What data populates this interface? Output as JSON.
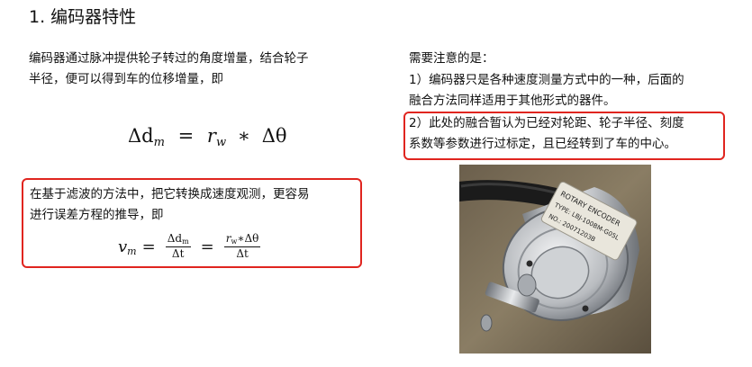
{
  "title": "1. 编码器特性",
  "left": {
    "paragraph_lines": [
      "编码器通过脉冲提供轮子转过的角度增量，结合轮子",
      "半径，便可以得到车的位移增量，即"
    ],
    "equation1": {
      "lhs": "Δd",
      "lhs_sub": "m",
      "equals": "=",
      "r": "r",
      "r_sub": "w",
      "times": "∗",
      "rhs": "Δθ"
    },
    "boxed": {
      "lines": [
        "在基于滤波的方法中，把它转换成速度观测，更容易",
        "进行误差方程的推导，即"
      ],
      "equation2": {
        "v": "v",
        "v_sub": "m",
        "equals1": "=",
        "frac1_num": "Δd",
        "frac1_num_sub": "m",
        "frac1_den": "Δt",
        "equals2": "=",
        "frac2_num_r": "r",
        "frac2_num_r_sub": "w",
        "frac2_num_rest": "∗Δθ",
        "frac2_den": "Δt"
      }
    }
  },
  "right": {
    "heading": "需要注意的是：",
    "note1_lines": [
      "1）编码器只是各种速度测量方式中的一种，后面的",
      "融合方法同样适用于其他形式的器件。"
    ],
    "note2_lines": [
      "2）此处的融合暂认为已经对轮距、轮子半径、刻度",
      "系数等参数进行过标定，且已经转到了车的中心。"
    ]
  },
  "photo": {
    "label_line1": "ROTARY ENCODER",
    "label_line2": "TYPE: LBJ-100BM-G05L",
    "label_line3": "NO.: 20071203B"
  },
  "colors": {
    "highlight_border": "#e0251f",
    "text": "#111111"
  }
}
